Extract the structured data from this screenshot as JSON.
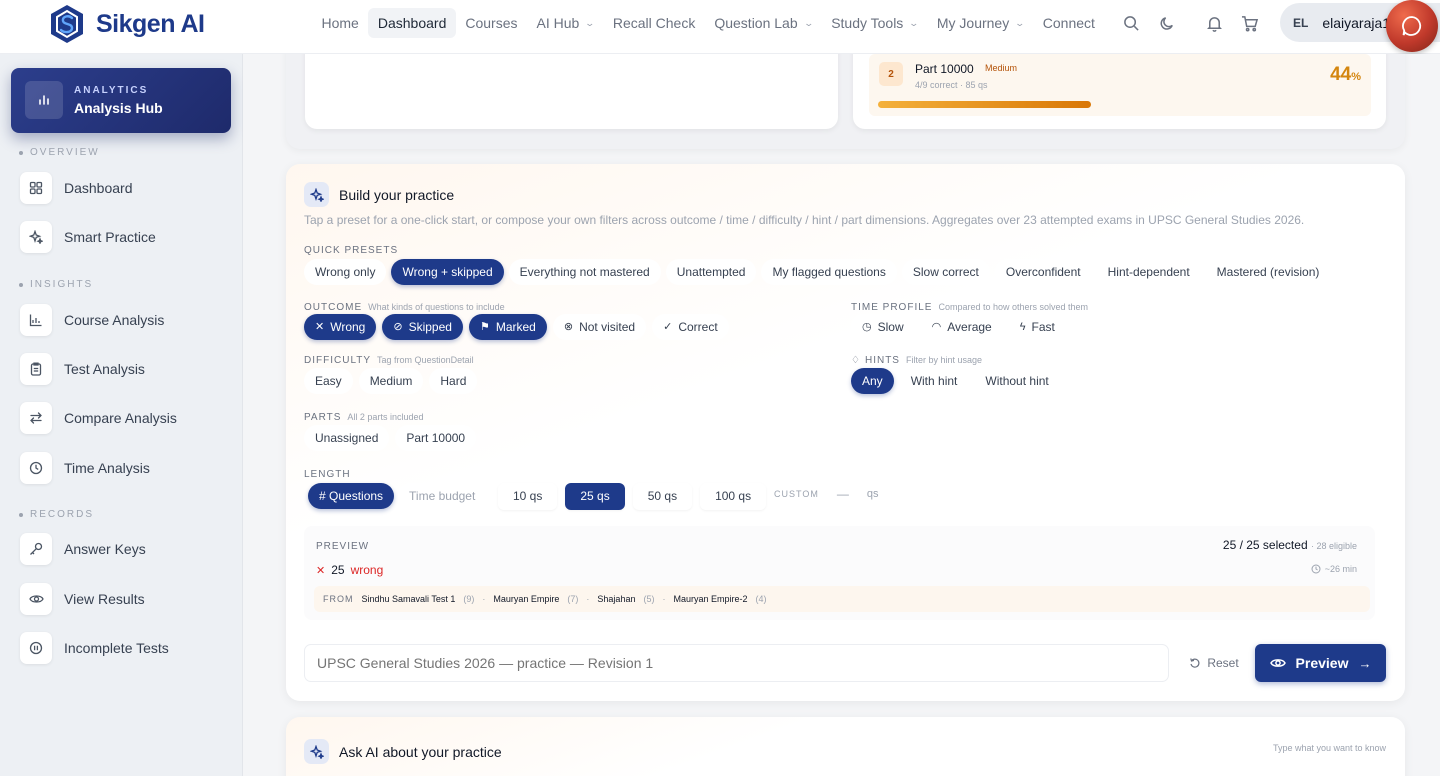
{
  "brand": {
    "name": "Sikgen AI"
  },
  "nav": {
    "links": [
      {
        "label": "Home",
        "active": false,
        "dropdown": false
      },
      {
        "label": "Dashboard",
        "active": true,
        "dropdown": false
      },
      {
        "label": "Courses",
        "active": false,
        "dropdown": false
      },
      {
        "label": "AI Hub",
        "active": false,
        "dropdown": true
      },
      {
        "label": "Recall Check",
        "active": false,
        "dropdown": false
      },
      {
        "label": "Question Lab",
        "active": false,
        "dropdown": true
      },
      {
        "label": "Study Tools",
        "active": false,
        "dropdown": true
      },
      {
        "label": "My Journey",
        "active": false,
        "dropdown": true
      },
      {
        "label": "Connect",
        "active": false,
        "dropdown": false
      }
    ],
    "icons": [
      "search-icon",
      "moon-icon",
      "bell-icon",
      "cart-icon"
    ],
    "user": {
      "initials": "EL",
      "name": "elaiyaraja1"
    }
  },
  "sidebar": {
    "hub": {
      "kicker": "ANALYTICS",
      "title": "Analysis Hub"
    },
    "sections": [
      {
        "label": "OVERVIEW"
      },
      {
        "label": "INSIGHTS"
      },
      {
        "label": "RECORDS"
      }
    ],
    "items": [
      {
        "label": "Dashboard",
        "icon": "grid-icon"
      },
      {
        "label": "Smart Practice",
        "icon": "sparkle-icon"
      },
      {
        "label": "Course Analysis",
        "icon": "line-chart-icon"
      },
      {
        "label": "Test Analysis",
        "icon": "clipboard-icon"
      },
      {
        "label": "Compare Analysis",
        "icon": "swap-icon"
      },
      {
        "label": "Time Analysis",
        "icon": "clock-icon"
      },
      {
        "label": "Answer Keys",
        "icon": "key-icon"
      },
      {
        "label": "View Results",
        "icon": "eye-icon"
      },
      {
        "label": "Incomplete Tests",
        "icon": "pause-icon"
      }
    ]
  },
  "part_card": {
    "num": "2",
    "name": "Part 10000",
    "badge": "Medium",
    "meta": "4/9 correct · 85 qs",
    "pct": "44",
    "pct_unit": "%",
    "progress": 0.44
  },
  "practice": {
    "title": "Build your practice",
    "subtitle": "Tap a preset for a one-click start, or compose your own filters across outcome / time / difficulty / hint / part dimensions. Aggregates over 23 attempted exams in UPSC General Studies 2026.",
    "presets_label": "QUICK PRESETS",
    "presets": [
      {
        "label": "Wrong only",
        "selected": false
      },
      {
        "label": "Wrong + skipped",
        "selected": true
      },
      {
        "label": "Everything not mastered",
        "selected": false
      },
      {
        "label": "Unattempted",
        "selected": false
      },
      {
        "label": "My flagged questions",
        "selected": false
      },
      {
        "label": "Slow correct",
        "selected": false
      },
      {
        "label": "Overconfident",
        "selected": false
      },
      {
        "label": "Hint-dependent",
        "selected": false
      },
      {
        "label": "Mastered (revision)",
        "selected": false
      }
    ],
    "outcome": {
      "label": "OUTCOME",
      "hint": "What kinds of questions to include",
      "options": [
        {
          "label": "Wrong",
          "icon": "✕",
          "selected": true
        },
        {
          "label": "Skipped",
          "icon": "⊘",
          "selected": true
        },
        {
          "label": "Marked",
          "icon": "⚑",
          "selected": true
        },
        {
          "label": "Not visited",
          "icon": "⊗",
          "selected": false
        },
        {
          "label": "Correct",
          "icon": "✓",
          "selected": false
        }
      ]
    },
    "time_profile": {
      "label": "TIME PROFILE",
      "hint": "Compared to how others solved them",
      "options": [
        {
          "label": "Slow",
          "icon": "◷",
          "selected": false
        },
        {
          "label": "Average",
          "icon": "◠",
          "selected": false
        },
        {
          "label": "Fast",
          "icon": "ϟ",
          "selected": false
        }
      ]
    },
    "difficulty": {
      "label": "DIFFICULTY",
      "hint": "Tag from QuestionDetail",
      "options": [
        {
          "label": "Easy",
          "selected": false
        },
        {
          "label": "Medium",
          "selected": false
        },
        {
          "label": "Hard",
          "selected": false
        }
      ]
    },
    "hints": {
      "label": "HINTS",
      "hint": "Filter by hint usage",
      "options": [
        {
          "label": "Any",
          "selected": true
        },
        {
          "label": "With hint",
          "selected": false
        },
        {
          "label": "Without hint",
          "selected": false
        }
      ]
    },
    "parts": {
      "label": "PARTS",
      "hint": "All 2 parts included",
      "options": [
        {
          "label": "Unassigned",
          "selected": false
        },
        {
          "label": "Part 10000",
          "selected": false
        }
      ]
    },
    "length": {
      "label": "LENGTH",
      "modes": [
        {
          "label": "# Questions",
          "selected": true
        },
        {
          "label": "Time budget",
          "selected": false
        }
      ],
      "sizes": [
        {
          "label": "10 qs",
          "selected": false
        },
        {
          "label": "25 qs",
          "selected": true
        },
        {
          "label": "50 qs",
          "selected": false
        },
        {
          "label": "100 qs",
          "selected": false
        }
      ],
      "custom_label": "CUSTOM",
      "custom_value": "—",
      "custom_unit": "qs"
    },
    "preview": {
      "kicker": "PREVIEW",
      "count": "25 / 25 selected",
      "eligible": "· 28 eligible",
      "wrong_count": "25",
      "wrong_label": "wrong",
      "time": "~26 min",
      "from_label": "FROM",
      "sources": [
        {
          "name": "Sindhu Samavali Test 1",
          "count": "(9)"
        },
        {
          "name": "Mauryan Empire",
          "count": "(7)"
        },
        {
          "name": "Shajahan",
          "count": "(5)"
        },
        {
          "name": "Mauryan Empire-2",
          "count": "(4)"
        }
      ]
    },
    "name_placeholder": "UPSC General Studies 2026 — practice — Revision 1",
    "reset_label": "Reset",
    "preview_label": "Preview"
  },
  "ai_card": {
    "title": "Ask AI about your practice",
    "hint": "Type what you want to know"
  },
  "colors": {
    "accent": "#1e3a8a",
    "warning": "#d4860f",
    "danger": "#dc2626"
  }
}
